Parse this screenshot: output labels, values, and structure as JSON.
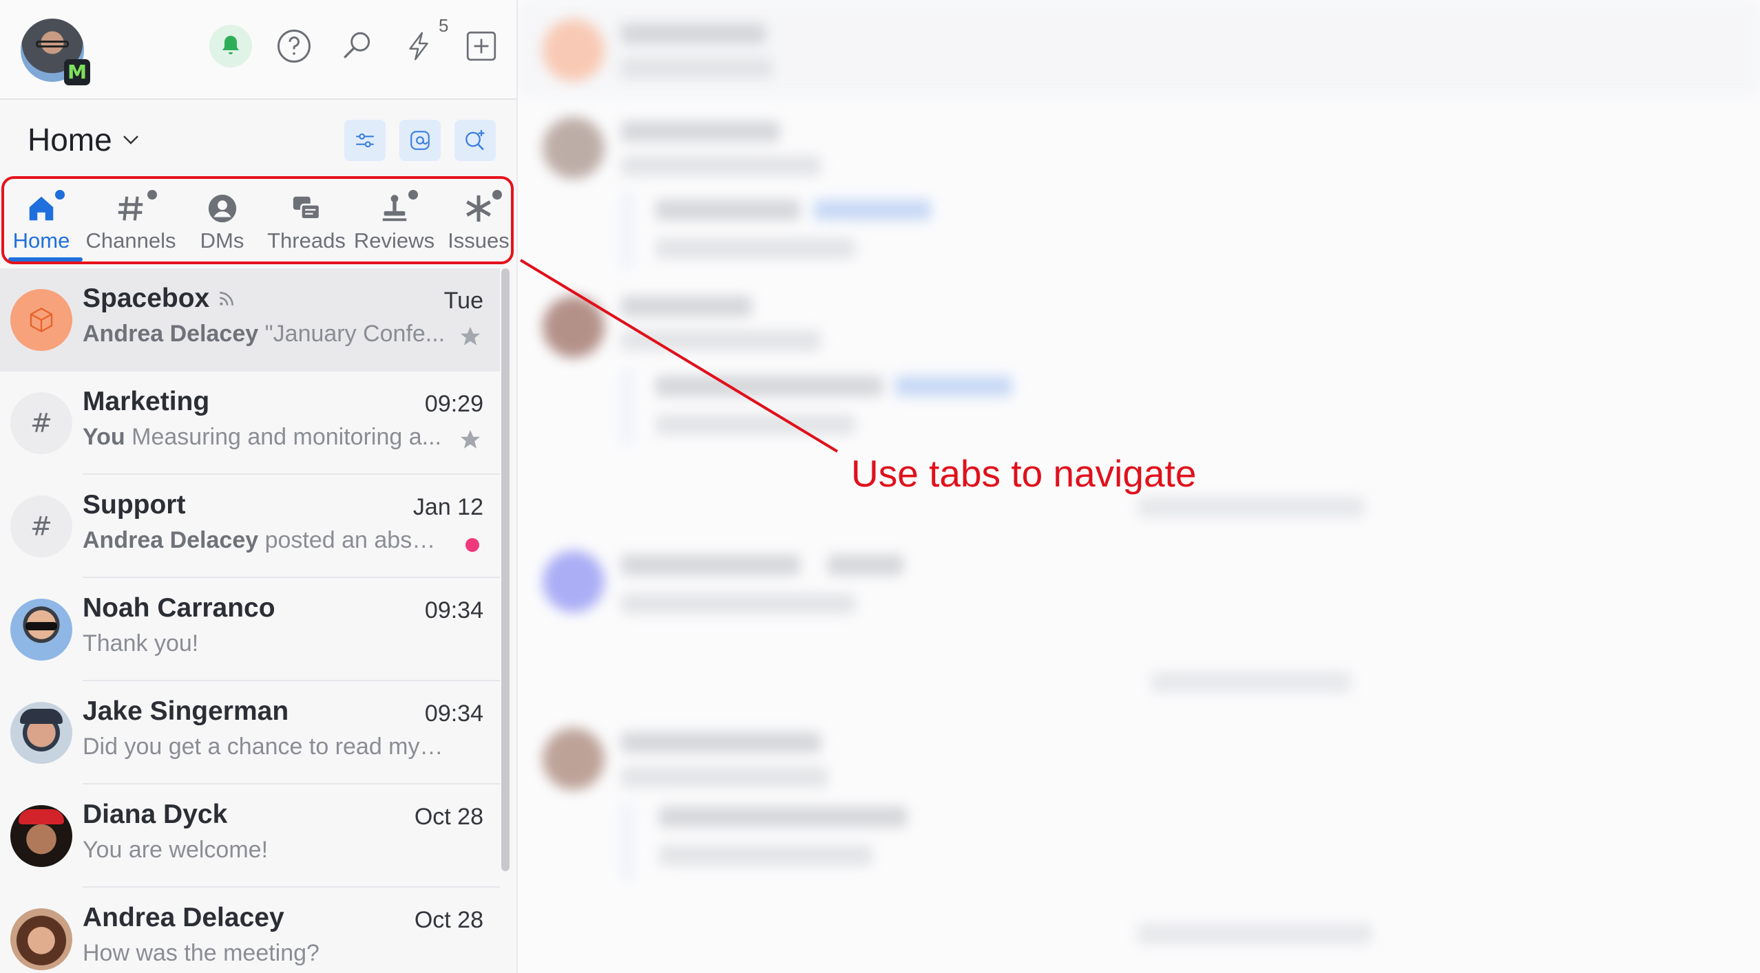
{
  "topbar": {
    "lightning_count": "5"
  },
  "header": {
    "title": "Home"
  },
  "tabs": [
    {
      "label": "Home",
      "active": true,
      "dot": true
    },
    {
      "label": "Channels",
      "active": false,
      "dot": true
    },
    {
      "label": "DMs",
      "active": false,
      "dot": false
    },
    {
      "label": "Threads",
      "active": false,
      "dot": false
    },
    {
      "label": "Reviews",
      "active": false,
      "dot": true
    },
    {
      "label": "Issues",
      "active": false,
      "dot": true
    }
  ],
  "conversations": [
    {
      "name": "Spacebox",
      "time": "Tue",
      "sender": "Andrea Delacey",
      "preview": "\"January Confe...",
      "starred": true
    },
    {
      "name": "Marketing",
      "time": "09:29",
      "sender": "You",
      "preview": "Measuring and monitoring a...",
      "starred": true
    },
    {
      "name": "Support",
      "time": "Jan 12",
      "sender": "Andrea Delacey",
      "preview": "posted an absen...",
      "unread": true
    },
    {
      "name": "Noah Carranco",
      "time": "09:34",
      "sender": "",
      "preview": "Thank you!"
    },
    {
      "name": "Jake Singerman",
      "time": "09:34",
      "sender": "",
      "preview": "Did you get a chance to read my c..."
    },
    {
      "name": "Diana Dyck",
      "time": "Oct 28",
      "sender": "",
      "preview": "You are welcome!"
    },
    {
      "name": "Andrea Delacey",
      "time": "Oct 28",
      "sender": "",
      "preview": "How was the meeting?"
    }
  ],
  "annotation": {
    "text": "Use tabs to navigate"
  },
  "colors": {
    "accent": "#1f6fdc",
    "annotation": "#e0101b",
    "unread": "#ee3a7a"
  }
}
